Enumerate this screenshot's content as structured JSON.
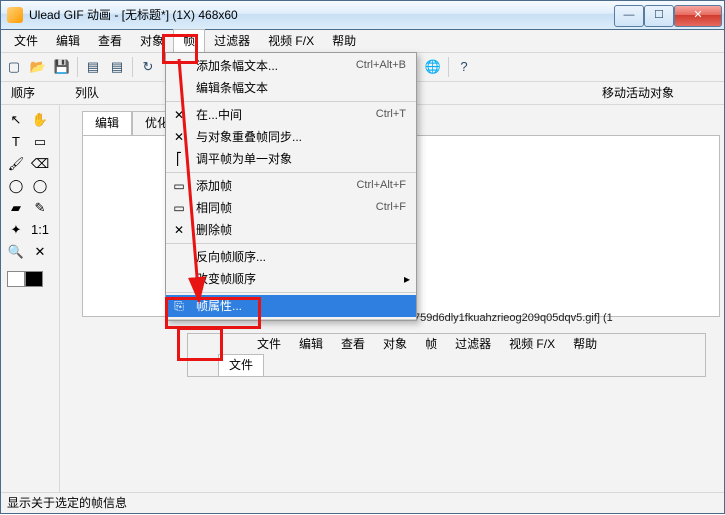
{
  "title": "Ulead GIF 动画 - [无标题*] (1X) 468x60",
  "menubar": [
    "文件",
    "编辑",
    "查看",
    "对象",
    "帧",
    "过滤器",
    "视频 F/X",
    "帮助"
  ],
  "active_menu_index": 4,
  "toolbar_icons": [
    "new",
    "open",
    "save",
    "sep",
    "copy1",
    "copy2",
    "sep",
    "redo",
    "undo",
    "sep",
    "tool1",
    "tool2",
    "tool3",
    "sep",
    "play",
    "pause",
    "stop",
    "sep",
    "misc1",
    "misc2",
    "browser",
    "globe",
    "sep",
    "help"
  ],
  "secondbar": {
    "left1": "顺序",
    "left2": "列队",
    "right": "移动活动对象"
  },
  "side_tools": [
    [
      "pointer",
      "hand"
    ],
    [
      "text",
      "rect"
    ],
    [
      "brush",
      "eraser"
    ],
    [
      "oval",
      "oval2"
    ],
    [
      "fill",
      "dropper"
    ],
    [
      "wand",
      "oneone"
    ],
    [
      "zoom",
      "cross"
    ]
  ],
  "swatches": [
    "#ffffff",
    "#000000"
  ],
  "tabs": [
    "编辑",
    "优化"
  ],
  "menu": {
    "sec1": [
      {
        "icon": "T",
        "label": "添加条幅文本...",
        "shortcut": "Ctrl+Alt+B"
      },
      {
        "icon": "",
        "label": "编辑条幅文本",
        "shortcut": ""
      }
    ],
    "sec2": [
      {
        "icon": "✕",
        "label": "在...中间",
        "shortcut": "Ctrl+T"
      },
      {
        "icon": "✕",
        "label": "与对象重叠帧同步...",
        "shortcut": ""
      },
      {
        "icon": "⎡",
        "label": "调平帧为单一对象",
        "shortcut": ""
      }
    ],
    "sec3": [
      {
        "icon": "▭",
        "label": "添加帧",
        "shortcut": "Ctrl+Alt+F"
      },
      {
        "icon": "▭",
        "label": "相同帧",
        "shortcut": "Ctrl+F"
      },
      {
        "icon": "✕",
        "label": "删除帧",
        "shortcut": ""
      }
    ],
    "sec4": [
      {
        "icon": "",
        "label": "反向帧顺序...",
        "shortcut": ""
      },
      {
        "icon": "",
        "label": "改变帧顺序",
        "shortcut": "",
        "submenu": true
      }
    ],
    "sec5": [
      {
        "icon": "⎘",
        "label": "帧属性...",
        "shortcut": ""
      }
    ]
  },
  "selected_menu_label_path": "menu.sec5.0.label",
  "path_text": "759d6dly1fkuahzrieog209q05dqv5.gif] (1",
  "nested_menubar": [
    "文件",
    "编辑",
    "查看",
    "对象",
    "帧",
    "过滤器",
    "视频 F/X",
    "帮助"
  ],
  "nested_tab": "文件",
  "status": "显示关于选定的帧信息"
}
